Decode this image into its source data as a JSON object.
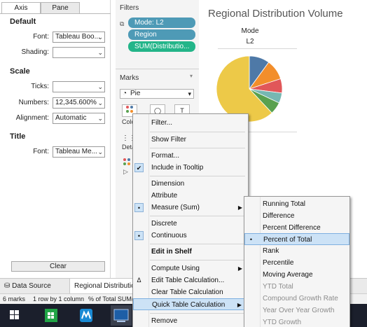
{
  "format_pane": {
    "tabs": [
      "Axis",
      "Pane"
    ],
    "default": {
      "heading": "Default",
      "font_label": "Font:",
      "font_value": "Tableau Boo...",
      "shading_label": "Shading:"
    },
    "scale": {
      "heading": "Scale",
      "ticks_label": "Ticks:",
      "numbers_label": "Numbers:",
      "numbers_value": "12,345.600%",
      "alignment_label": "Alignment:",
      "alignment_value": "Automatic"
    },
    "title": {
      "heading": "Title",
      "font_label": "Font:",
      "font_value": "Tableau Me..."
    },
    "clear_button": "Clear"
  },
  "filters": {
    "title": "Filters",
    "pills": [
      "Mode: L2",
      "Region",
      "SUM(Distributio..."
    ]
  },
  "marks": {
    "title": "Marks",
    "type": "Pie",
    "color_caption": "Colo",
    "detail_caption": "Deta"
  },
  "view": {
    "title": "Regional Distribution Volume",
    "column_header": "Mode",
    "column_value": "L2",
    "pie_slices": [
      {
        "label": "blue",
        "value": 10,
        "color": "#4e79a7"
      },
      {
        "label": "orange",
        "value": 10,
        "color": "#f28e2b"
      },
      {
        "label": "red",
        "value": 7,
        "color": "#e15759"
      },
      {
        "label": "teal",
        "value": 5,
        "color": "#76b7b2"
      },
      {
        "label": "green",
        "value": 6,
        "color": "#59a14f"
      },
      {
        "label": "yellow",
        "value": 62,
        "color": "#edc948"
      }
    ]
  },
  "bottom_tabs": {
    "data_source": "Data Source",
    "sheet": "Regional Distributio"
  },
  "status_bar": {
    "marks": "6 marks",
    "rows": "1 row by 1 column",
    "total": "% of Total SUM("
  },
  "context_menu": {
    "items": {
      "filter": "Filter...",
      "show_filter": "Show Filter",
      "format": "Format...",
      "include_tooltip": "Include in Tooltip",
      "dimension": "Dimension",
      "attribute": "Attribute",
      "measure_sum": "Measure (Sum)",
      "discrete": "Discrete",
      "continuous": "Continuous",
      "edit_in_shelf": "Edit in Shelf",
      "compute_using": "Compute Using",
      "edit_table_calc": "Edit Table Calculation...",
      "clear_table_calc": "Clear Table Calculation",
      "quick_table_calc": "Quick Table Calculation",
      "remove": "Remove"
    },
    "check_glyph": "✔",
    "bullet_glyph": "•",
    "delta_glyph": "Δ"
  },
  "submenu": {
    "items": {
      "running_total": "Running Total",
      "difference": "Difference",
      "percent_difference": "Percent Difference",
      "percent_of_total": "Percent of Total",
      "rank": "Rank",
      "percentile": "Percentile",
      "moving_average": "Moving Average",
      "ytd_total": "YTD Total",
      "compound_growth_rate": "Compound Growth Rate",
      "year_over_year_growth": "Year Over Year Growth",
      "ytd_growth": "YTD Growth"
    }
  },
  "colors": {
    "pill_blue": "#4e9ab6",
    "pill_green": "#23b589",
    "menu_highlight": "#cce2f6",
    "taskbar": "#1b1f2c"
  }
}
